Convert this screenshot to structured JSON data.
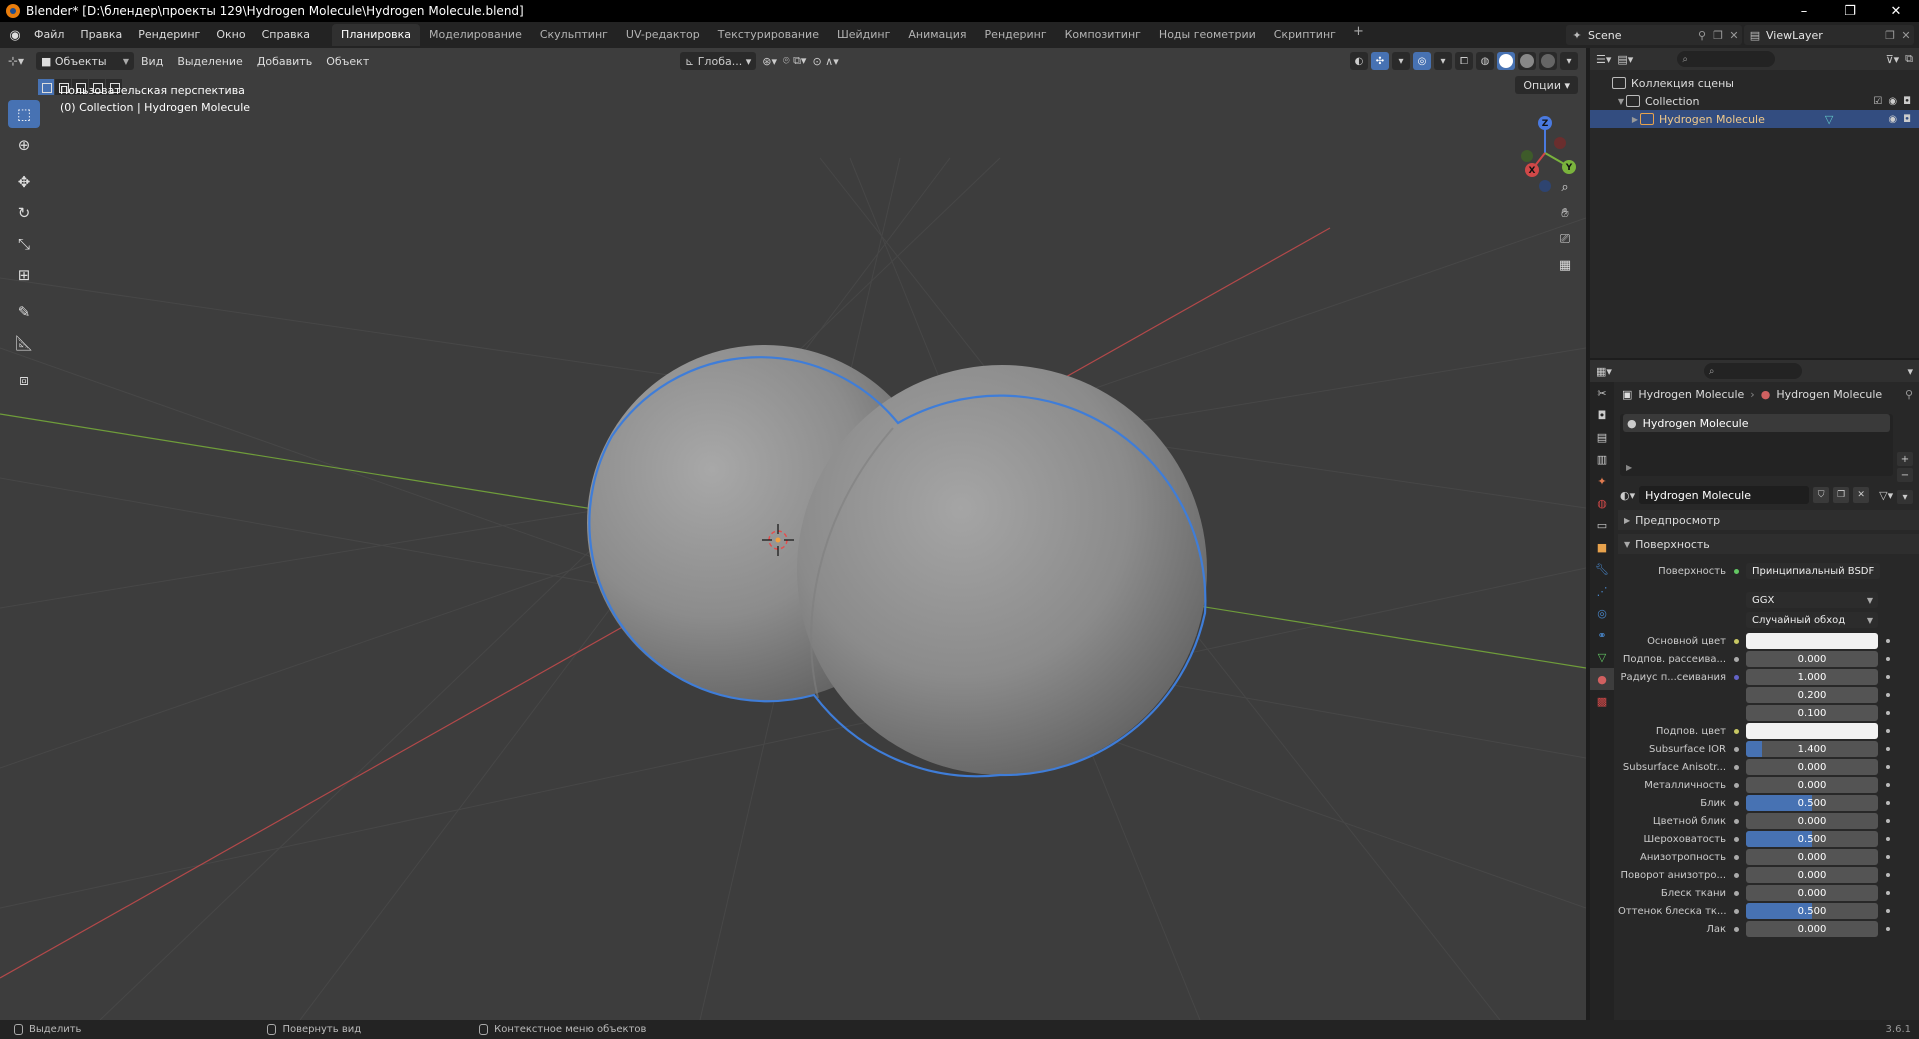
{
  "window": {
    "title": "Blender* [D:\\блендер\\проекты 129\\Hydrogen Molecule\\Hydrogen Molecule.blend]",
    "minimize": "–",
    "maximize": "❐",
    "close": "✕"
  },
  "topbar": {
    "menus": [
      "Файл",
      "Правка",
      "Рендеринг",
      "Окно",
      "Справка"
    ],
    "workspaces": [
      "Планировка",
      "Моделирование",
      "Скульптинг",
      "UV-редактор",
      "Текстурирование",
      "Шейдинг",
      "Анимация",
      "Рендеринг",
      "Композитинг",
      "Ноды геометрии",
      "Скриптинг"
    ],
    "active_workspace": "Планировка",
    "add_tab": "+",
    "scene": "Scene",
    "view_layer": "ViewLayer"
  },
  "viewport": {
    "mode": "Объекты",
    "menus": [
      "Вид",
      "Выделение",
      "Добавить",
      "Объект"
    ],
    "transform_orientation": "Глоба...",
    "options": "Опции",
    "info_line1": "Пользовательская перспектива",
    "info_line2": "(0) Collection | Hydrogen Molecule",
    "gizmo": {
      "x": "X",
      "y": "Y",
      "z": "Z"
    }
  },
  "outliner": {
    "scene_collection": "Коллекция сцены",
    "collection": "Collection",
    "object": "Hydrogen Molecule"
  },
  "properties": {
    "breadcrumb_object": "Hydrogen Molecule",
    "breadcrumb_material": "Hydrogen Molecule",
    "slot": "Hydrogen Molecule",
    "material_name": "Hydrogen Molecule",
    "panel_preview": "Предпросмотр",
    "panel_surface": "Поверхность",
    "surface_label": "Поверхность",
    "surface_shader": "Принципиальный BSDF",
    "distribution": "GGX",
    "subsurface_method": "Случайный обход",
    "rows": [
      {
        "label": "Основной цвет",
        "value": "",
        "kind": "white",
        "dot": "yellow"
      },
      {
        "label": "Подпов. рассеива...",
        "value": "0.000",
        "kind": "num",
        "fill": 0,
        "dot": "gray"
      },
      {
        "label": "Радиус п...сеивания",
        "value": "1.000",
        "kind": "num",
        "fill": 0,
        "dot": "blue"
      },
      {
        "label": "",
        "value": "0.200",
        "kind": "num",
        "fill": 0,
        "dot": "none"
      },
      {
        "label": "",
        "value": "0.100",
        "kind": "num",
        "fill": 0,
        "dot": "none"
      },
      {
        "label": "Подпов. цвет",
        "value": "",
        "kind": "white",
        "dot": "yellow"
      },
      {
        "label": "Subsurface IOR",
        "value": "1.400",
        "kind": "num",
        "fill": 0.12,
        "dot": "gray"
      },
      {
        "label": "Subsurface Anisotr...",
        "value": "0.000",
        "kind": "num",
        "fill": 0,
        "dot": "gray"
      },
      {
        "label": "Металличность",
        "value": "0.000",
        "kind": "num",
        "fill": 0,
        "dot": "gray"
      },
      {
        "label": "Блик",
        "value": "0.500",
        "kind": "num",
        "fill": 0.5,
        "dot": "gray"
      },
      {
        "label": "Цветной блик",
        "value": "0.000",
        "kind": "num",
        "fill": 0,
        "dot": "gray"
      },
      {
        "label": "Шероховатость",
        "value": "0.500",
        "kind": "num",
        "fill": 0.5,
        "dot": "gray"
      },
      {
        "label": "Анизотропность",
        "value": "0.000",
        "kind": "num",
        "fill": 0,
        "dot": "gray"
      },
      {
        "label": "Поворот анизотро...",
        "value": "0.000",
        "kind": "num",
        "fill": 0,
        "dot": "gray"
      },
      {
        "label": "Блеск ткани",
        "value": "0.000",
        "kind": "num",
        "fill": 0,
        "dot": "gray"
      },
      {
        "label": "Оттенок блеска тк...",
        "value": "0.500",
        "kind": "num",
        "fill": 0.5,
        "dot": "gray"
      },
      {
        "label": "Лак",
        "value": "0.000",
        "kind": "num",
        "fill": 0,
        "dot": "gray"
      }
    ]
  },
  "statusbar": {
    "select": "Выделить",
    "rotate": "Повернуть вид",
    "context": "Контекстное меню объектов",
    "version": "3.6.1"
  },
  "colors": {
    "accent": "#4772b3",
    "selection_outline": "#3f7dd8",
    "x_axis": "#b3494a",
    "y_axis": "#6f9d3a"
  }
}
